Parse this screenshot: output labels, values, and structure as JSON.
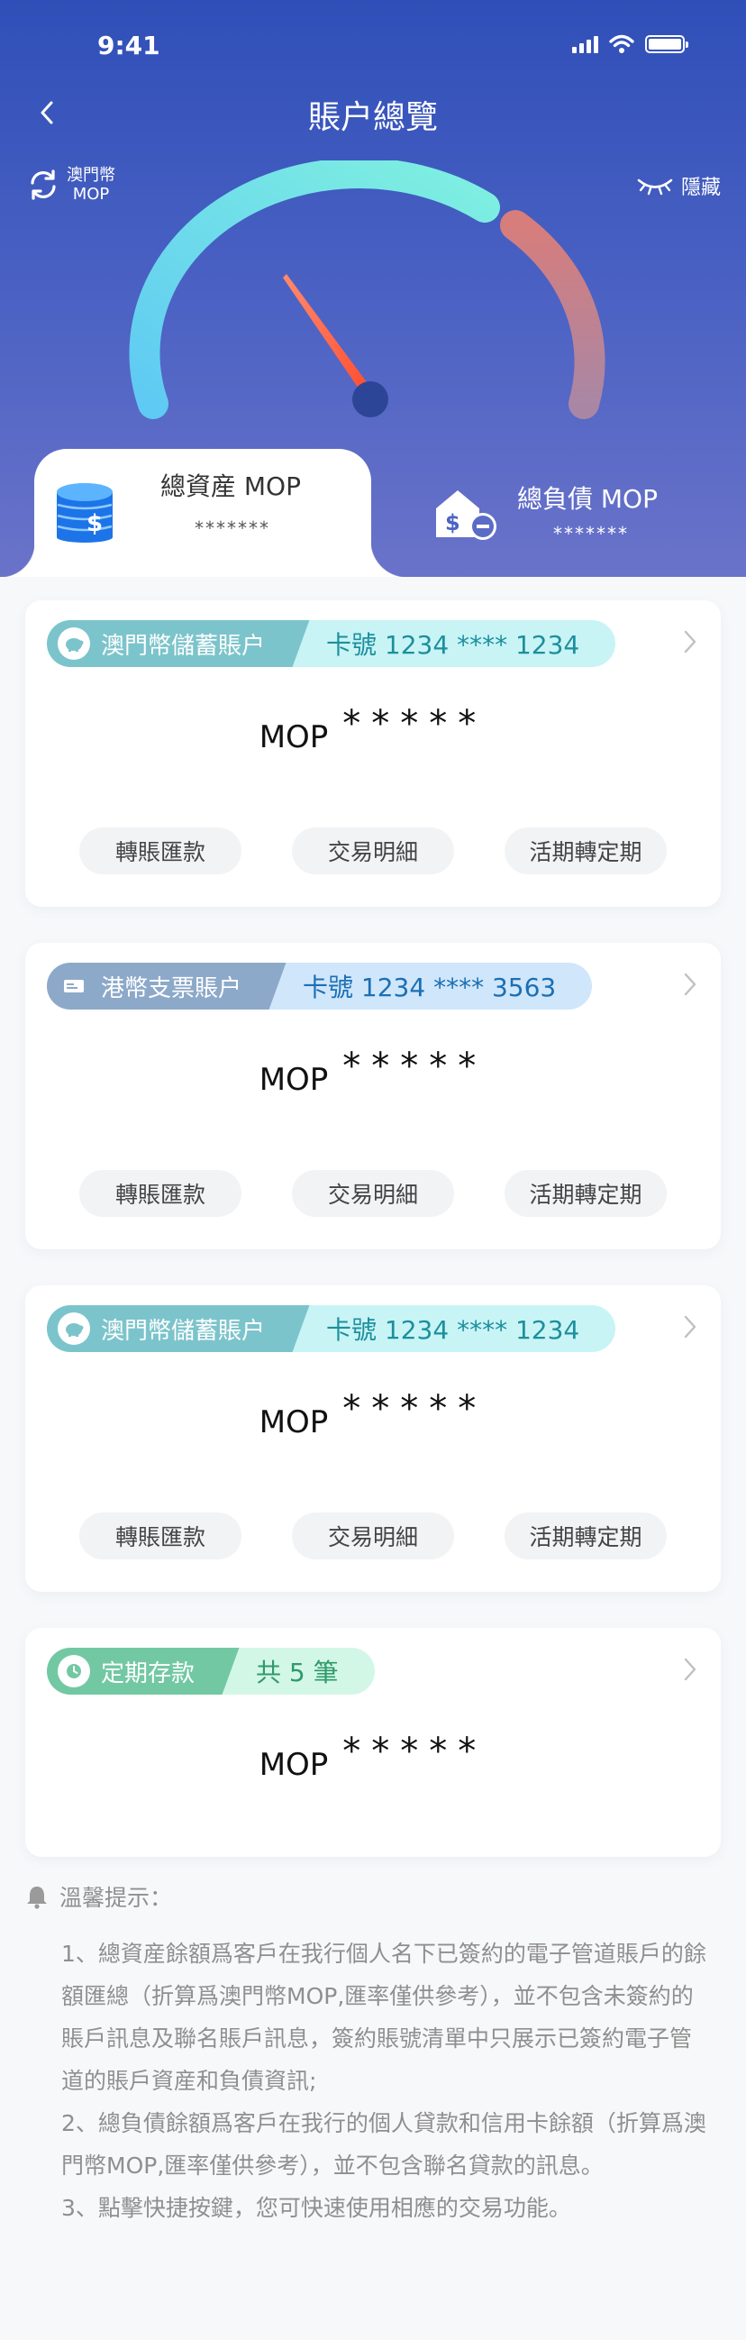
{
  "status_bar": {
    "time": "9:41"
  },
  "nav": {
    "title": "賬户總覽"
  },
  "currency_switch": {
    "line1": "澳門幣",
    "line2": "MOP"
  },
  "hide_toggle": {
    "label": "隱藏"
  },
  "gauge": {
    "assets_color": "#7ff0e0",
    "liab_color": "#c17f8a",
    "needle_color": "#ff5a44"
  },
  "summary": {
    "assets_label": "總資産 MOP",
    "assets_value": "*******",
    "liab_label": "總負債 MOP",
    "liab_value": "*******"
  },
  "accounts": [
    {
      "type": "澳門幣儲蓄賬户",
      "card_no": "卡號 1234 **** 1234",
      "currency": "MOP",
      "balance": "*****",
      "actions": [
        "轉賬匯款",
        "交易明細",
        "活期轉定期"
      ]
    },
    {
      "type": "港幣支票賬户",
      "card_no": "卡號 1234 **** 3563",
      "currency": "MOP",
      "balance": "*****",
      "actions": [
        "轉賬匯款",
        "交易明細",
        "活期轉定期"
      ]
    },
    {
      "type": "澳門幣儲蓄賬户",
      "card_no": "卡號 1234 **** 1234",
      "currency": "MOP",
      "balance": "*****",
      "actions": [
        "轉賬匯款",
        "交易明細",
        "活期轉定期"
      ]
    }
  ],
  "fixed_deposit": {
    "type": "定期存款",
    "count": "共 5 筆",
    "currency": "MOP",
    "balance": "*****"
  },
  "notes": {
    "title": "溫馨提示：",
    "items": [
      "1、總資産餘額爲客戶在我行個人名下已簽約的電子管道賬戶的餘額匯總（折算爲澳門幣MOP,匯率僅供參考），並不包含未簽約的賬戶訊息及聯名賬戶訊息，簽約賬號清單中只展示已簽約電子管道的賬戶資産和負債資訊;",
      "2、總負債餘額爲客戶在我行的個人貸款和信用卡餘額（折算爲澳門幣MOP,匯率僅供參考），並不包含聯名貸款的訊息。",
      "3、點擊快捷按鍵，您可快速使用相應的交易功能。"
    ]
  }
}
